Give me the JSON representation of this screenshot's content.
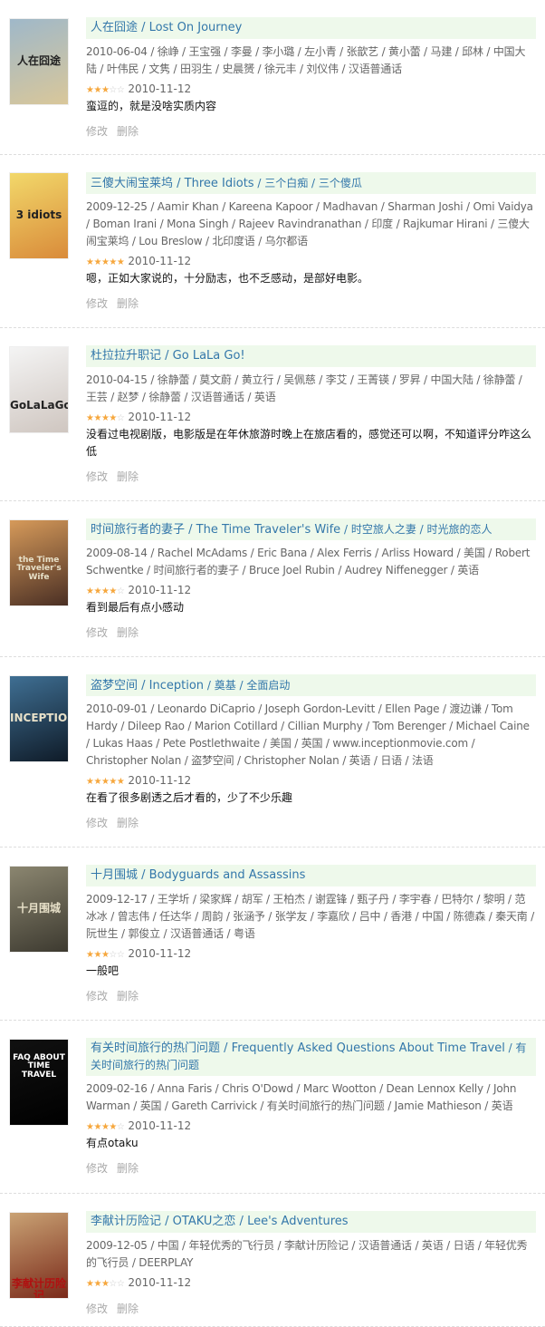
{
  "actions": {
    "edit": "修改",
    "delete": "删除"
  },
  "items": [
    {
      "title": "人在囧途",
      "subtitle": "Lost On Journey",
      "meta": "2010-06-04 / 徐峥 / 王宝强 / 李曼 / 李小璐 / 左小青 / 张歆艺 / 黄小蕾 / 马建 / 邱林 / 中国大陆 / 叶伟民 / 文隽 / 田羽生 / 史晨赟 / 徐元丰 / 刘仪伟 / 汉语普通话",
      "rating": 3,
      "date": "2010-11-12",
      "comment": "蛮逗的，就是没啥实质内容",
      "poster_text": "人在囧途",
      "poster_colors": [
        "#9fb8c9",
        "#d9c79a"
      ]
    },
    {
      "title": "三傻大闹宝莱坞",
      "subtitle": "Three Idiots",
      "alts": "三个白痴 / 三个傻瓜",
      "meta": "2009-12-25 / Aamir Khan / Kareena Kapoor / Madhavan / Sharman Joshi / Omi Vaidya / Boman Irani / Mona Singh / Rajeev Ravindranathan / 印度 / Rajkumar Hirani / 三傻大闹宝莱坞 / Lou Breslow / 北印度语 / 乌尔都语",
      "rating": 5,
      "date": "2010-11-12",
      "comment": "嗯，正如大家说的，十分励志，也不乏感动，是部好电影。",
      "poster_text": "3 idiots",
      "poster_colors": [
        "#f2d86a",
        "#d98b3a"
      ]
    },
    {
      "title": "杜拉拉升职记",
      "subtitle": "Go LaLa Go!",
      "meta": "2010-04-15 / 徐静蕾 / 莫文蔚 / 黄立行 / 吴佩慈 / 李艾 / 王菁锳 / 罗昇 / 中国大陆 / 徐静蕾 / 王芸 / 赵梦 / 徐静蕾 / 汉语普通话 / 英语",
      "rating": 4,
      "date": "2010-11-12",
      "comment": "没看过电视剧版，电影版是在年休旅游时晚上在旅店看的，感觉还可以啊，不知道评分咋这么低",
      "poster_text": "GoLaLaGo!",
      "poster_colors": [
        "#f4f4f4",
        "#cfc6c0"
      ]
    },
    {
      "title": "时间旅行者的妻子",
      "subtitle": "The Time Traveler's Wife",
      "alts": "时空旅人之妻 / 时光旅的恋人",
      "meta": "2009-08-14 / Rachel McAdams / Eric Bana / Alex Ferris / Arliss Howard / 美国 / Robert Schwentke / 时间旅行者的妻子 / Bruce Joel Rubin / Audrey Niffenegger / 英语",
      "rating": 4,
      "date": "2010-11-12",
      "comment": "看到最后有点小感动",
      "poster_text": "the Time Traveler's Wife",
      "poster_colors": [
        "#d69a5a",
        "#4a2f24"
      ]
    },
    {
      "title": "盗梦空间",
      "subtitle": "Inception",
      "alts": "奠基 / 全面启动",
      "meta": "2010-09-01 / Leonardo DiCaprio / Joseph Gordon-Levitt / Ellen Page / 渡边谦 / Tom Hardy / Dileep Rao / Marion Cotillard / Cillian Murphy / Tom Berenger / Michael Caine / Lukas Haas / Pete Postlethwaite / 美国 / 英国 / www.inceptionmovie.com / Christopher Nolan / 盗梦空间 / Christopher Nolan / 英语 / 日语 / 法语",
      "rating": 5,
      "date": "2010-11-12",
      "comment": "在看了很多剧透之后才看的，少了不少乐趣",
      "poster_text": "INCEPTION",
      "poster_colors": [
        "#3f6f93",
        "#0f1b28"
      ]
    },
    {
      "title": "十月围城",
      "subtitle": "Bodyguards and Assassins",
      "meta": "2009-12-17 / 王学圻 / 梁家辉 / 胡军 / 王柏杰 / 谢霆锋 / 甄子丹 / 李宇春 / 巴特尔 / 黎明 / 范冰冰 / 曾志伟 / 任达华 / 周韵 / 张涵予 / 张学友 / 李嘉欣 / 吕中 / 香港 / 中国 / 陈德森 / 秦天南 / 阮世生 / 郭俊立 / 汉语普通话 / 粤语",
      "rating": 3,
      "date": "2010-11-12",
      "comment": "一般吧",
      "poster_text": "十月围城",
      "poster_colors": [
        "#8b8670",
        "#3d3a30"
      ]
    },
    {
      "title": "有关时间旅行的热门问题",
      "subtitle": "Frequently Asked Questions About Time Travel",
      "alts": "有关时间旅行的热门问题",
      "meta": "2009-02-16 / Anna Faris / Chris O'Dowd / Marc Wootton / Dean Lennox Kelly / John Warman / 英国 / Gareth Carrivick / 有关时间旅行的热门问题 / Jamie Mathieson / 英语",
      "rating": 4,
      "date": "2010-11-12",
      "comment": "有点otaku",
      "poster_text": "FAQ ABOUT TIME TRAVEL",
      "poster_colors": [
        "#111111",
        "#000000"
      ]
    },
    {
      "title": "李献计历险记",
      "subtitle": "OTAKU之恋 / Lee's Adventures",
      "meta": "2009-12-05 / 中国 / 年轻优秀的飞行员 / 李献计历险记 / 汉语普通话 / 英语 / 日语 / 年轻优秀的飞行员 / DEERPLAY",
      "rating": 3,
      "date": "2010-11-12",
      "comment": "",
      "poster_text": "李献计历险记",
      "poster_colors": [
        "#c9a274",
        "#7a2a1a"
      ]
    }
  ]
}
